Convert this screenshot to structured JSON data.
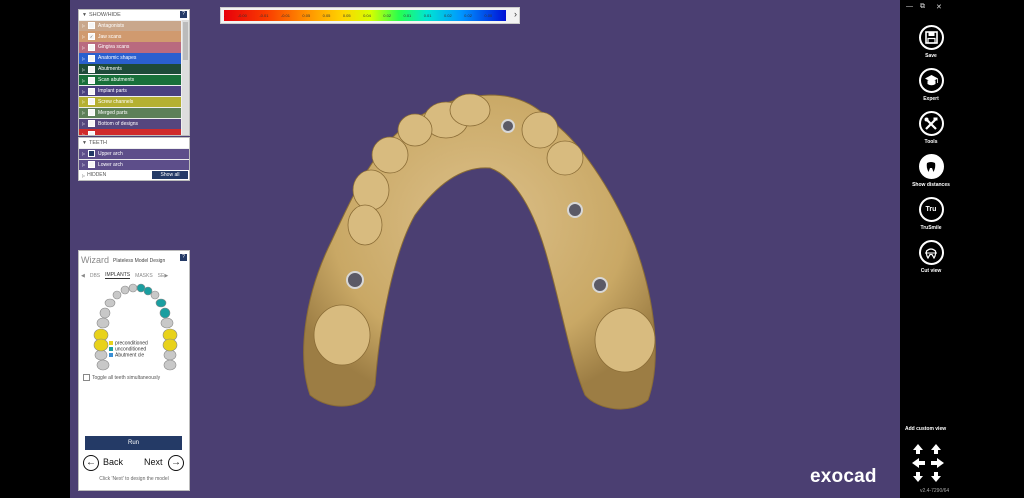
{
  "scale": {
    "ticks": [
      "-",
      "-0.00",
      "-0.01",
      "-0.01",
      "0.05",
      "0.05",
      "0.05",
      "0.04",
      "0.02",
      "0.01",
      "0.01",
      "0.02",
      "0.02",
      "0.00",
      "-"
    ],
    "arrow": "›"
  },
  "showhide": {
    "title": "SHOW/HIDE",
    "help": "?",
    "items": [
      {
        "label": "Antagonists",
        "color": "#c9a78c",
        "checked": false
      },
      {
        "label": "Jaw scans",
        "color": "#d09a6f",
        "checked": true
      },
      {
        "label": "Gingiva scans",
        "color": "#b96a7f",
        "checked": false
      },
      {
        "label": "Anatomic shapes",
        "color": "#2a5fcf",
        "checked": false
      },
      {
        "label": "Abutments",
        "color": "#1e4a39",
        "checked": false
      },
      {
        "label": "Scan abutments",
        "color": "#18703a",
        "checked": false
      },
      {
        "label": "Implant parts",
        "color": "#4a4180",
        "checked": false
      },
      {
        "label": "Screw channels",
        "color": "#b5b032",
        "checked": false
      },
      {
        "label": "Merged parts",
        "color": "#5d8059",
        "checked": false
      },
      {
        "label": "Bottom of designs",
        "color": "#55467e",
        "checked": false
      },
      {
        "label": "",
        "color": "#cf2b2b",
        "checked": false
      }
    ]
  },
  "teeth": {
    "title": "TEETH",
    "rows": [
      {
        "label": "Upper arch",
        "filled": true
      },
      {
        "label": "Lower arch",
        "filled": false
      }
    ],
    "hidden_label": "HIDDEN",
    "show_all": "Show all"
  },
  "wizard": {
    "title": "Wizard",
    "subtitle": "Plateless Model Design",
    "help": "?",
    "tabs": [
      "◀",
      "DBS",
      "IMPLANTS",
      "MASKS",
      "SE▶"
    ],
    "active_tab": "IMPLANTS",
    "legend": [
      {
        "label": "preconditioned",
        "color": "#e8d21b"
      },
      {
        "label": "unconditioned",
        "color": "#1a9ea0"
      },
      {
        "label": "Abutment cle",
        "color": "#3a8fd6"
      }
    ],
    "toggle_label": "Toggle all teeth simultaneously",
    "run": "Run",
    "back": "Back",
    "next": "Next",
    "back_icon": "←",
    "next_icon": "→",
    "hint": "Click 'Next' to design the model"
  },
  "toolbar": {
    "minimize": "—",
    "restore": "⧉",
    "close": "✕",
    "tools": [
      {
        "label": "Save",
        "icon": "save-icon"
      },
      {
        "label": "Expert",
        "icon": "graduation-cap-icon"
      },
      {
        "label": "Tools",
        "icon": "tools-icon"
      },
      {
        "label": "Show distances",
        "icon": "tooth-distance-icon"
      },
      {
        "label": "TruSmile",
        "icon": "trusmile-icon"
      },
      {
        "label": "Cut view",
        "icon": "cut-view-icon"
      }
    ],
    "add_custom_view": "Add custom view",
    "version": "v2.4-7290/64"
  },
  "logo": "exocad"
}
